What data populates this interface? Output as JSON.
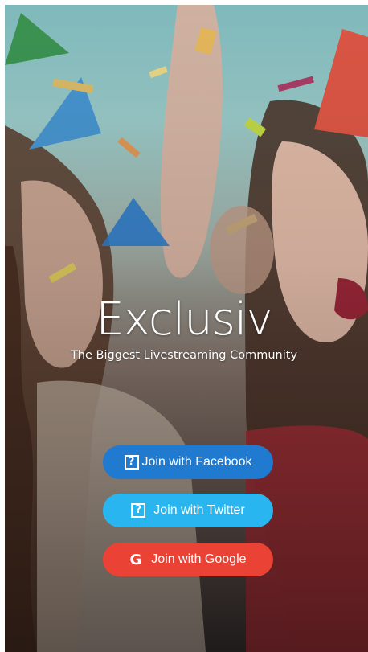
{
  "app": {
    "name": "Exclusiv",
    "tagline": "The Biggest Livestreaming Community"
  },
  "background": {
    "icon": "party-photo"
  },
  "buttons": [
    {
      "id": "facebook",
      "label": "Join with Facebook",
      "icon": "question-box-icon",
      "color": "#1f7ad0"
    },
    {
      "id": "twitter",
      "label": "Join with Twitter",
      "icon": "question-box-icon",
      "color": "#29b6f0"
    },
    {
      "id": "google",
      "label": "Join with Google",
      "icon": "google-g-icon",
      "icon_glyph": "G",
      "color": "#ea4335"
    }
  ]
}
